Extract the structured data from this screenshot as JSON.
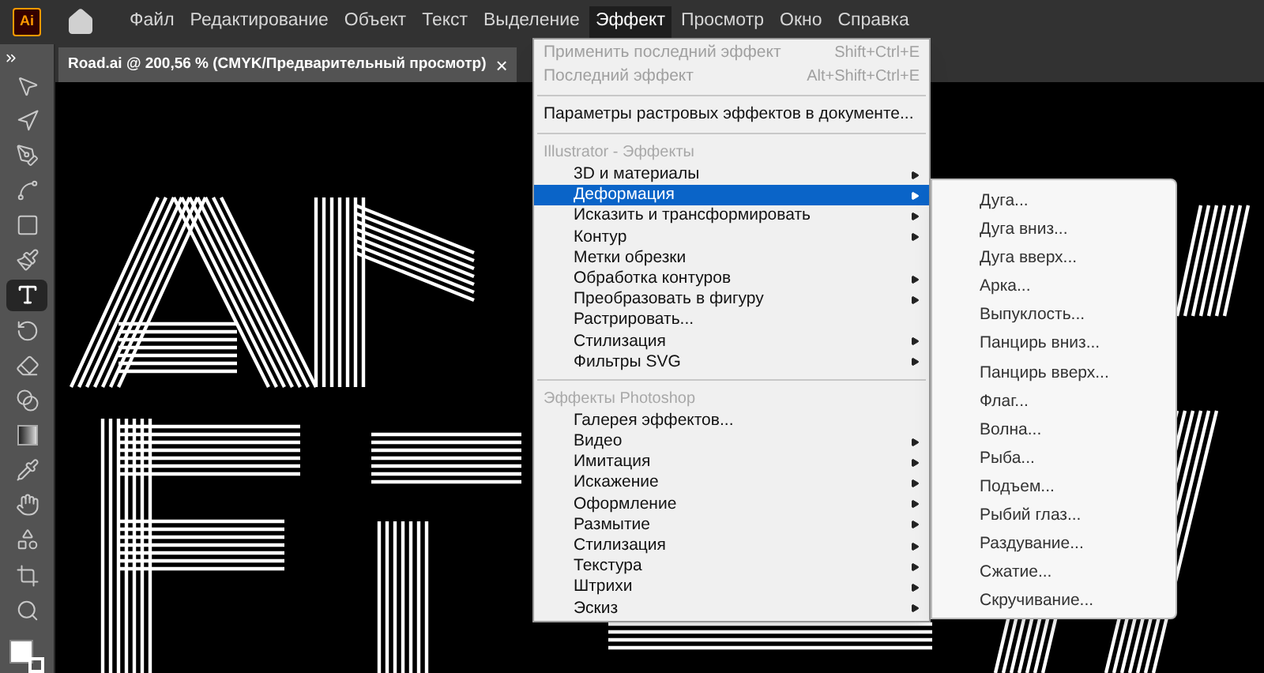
{
  "app": {
    "logo": "Ai"
  },
  "menubar": [
    {
      "label": "Файл",
      "selected": false
    },
    {
      "label": "Редактирование",
      "selected": false
    },
    {
      "label": "Объект",
      "selected": false
    },
    {
      "label": "Текст",
      "selected": false
    },
    {
      "label": "Выделение",
      "selected": false
    },
    {
      "label": "Эффект",
      "selected": true
    },
    {
      "label": "Просмотр",
      "selected": false
    },
    {
      "label": "Окно",
      "selected": false
    },
    {
      "label": "Справка",
      "selected": false
    }
  ],
  "document_tab": {
    "title": "Road.ai @ 200,56 % (CMYK/Предварительный просмотр)",
    "close": "×"
  },
  "tools": [
    {
      "kind": "select",
      "selected": false
    },
    {
      "kind": "direct",
      "selected": false
    },
    {
      "kind": "pen",
      "selected": false
    },
    {
      "kind": "curvature",
      "selected": false
    },
    {
      "kind": "rectangle",
      "selected": false
    },
    {
      "kind": "brush",
      "selected": false
    },
    {
      "kind": "type",
      "selected": true
    },
    {
      "kind": "rotate",
      "selected": false
    },
    {
      "kind": "eraser",
      "selected": false
    },
    {
      "kind": "shapebuilder",
      "selected": false
    },
    {
      "kind": "gradient",
      "selected": false
    },
    {
      "kind": "eyedropper",
      "selected": false
    },
    {
      "kind": "puppet",
      "selected": false
    },
    {
      "kind": "shapes",
      "selected": false
    },
    {
      "kind": "artboard",
      "selected": false
    },
    {
      "kind": "zoom",
      "selected": false
    }
  ],
  "effect_menu": [
    {
      "kind": "item",
      "label": "Применить последний эффект",
      "shortcut": "Shift+Ctrl+E",
      "disabled": true,
      "submenu": false,
      "selected": false
    },
    {
      "kind": "item",
      "label": "Последний эффект",
      "shortcut": "Alt+Shift+Ctrl+E",
      "disabled": true,
      "submenu": false,
      "selected": false
    },
    {
      "kind": "separator"
    },
    {
      "kind": "item",
      "label": "Параметры растровых эффектов в документе...",
      "disabled": false,
      "submenu": false,
      "selected": false
    },
    {
      "kind": "separator"
    },
    {
      "kind": "header",
      "label": "Illustrator - Эффекты"
    },
    {
      "kind": "item",
      "label": "3D и материалы",
      "disabled": false,
      "submenu": true,
      "selected": false
    },
    {
      "kind": "item",
      "label": "Деформация",
      "disabled": false,
      "submenu": true,
      "selected": true
    },
    {
      "kind": "item",
      "label": "Исказить и трансформировать",
      "disabled": false,
      "submenu": true,
      "selected": false
    },
    {
      "kind": "item",
      "label": "Контур",
      "disabled": false,
      "submenu": true,
      "selected": false
    },
    {
      "kind": "item",
      "label": "Метки обрезки",
      "disabled": false,
      "submenu": false,
      "selected": false
    },
    {
      "kind": "item",
      "label": "Обработка контуров",
      "disabled": false,
      "submenu": true,
      "selected": false
    },
    {
      "kind": "item",
      "label": "Преобразовать в фигуру",
      "disabled": false,
      "submenu": true,
      "selected": false
    },
    {
      "kind": "item",
      "label": "Растрировать...",
      "disabled": false,
      "submenu": false,
      "selected": false
    },
    {
      "kind": "item",
      "label": "Стилизация",
      "disabled": false,
      "submenu": true,
      "selected": false
    },
    {
      "kind": "item",
      "label": "Фильтры SVG",
      "disabled": false,
      "submenu": true,
      "selected": false
    },
    {
      "kind": "separator"
    },
    {
      "kind": "header",
      "label": "Эффекты Photoshop"
    },
    {
      "kind": "item",
      "label": "Галерея эффектов...",
      "disabled": false,
      "submenu": false,
      "selected": false
    },
    {
      "kind": "item",
      "label": "Видео",
      "disabled": false,
      "submenu": true,
      "selected": false
    },
    {
      "kind": "item",
      "label": "Имитация",
      "disabled": false,
      "submenu": true,
      "selected": false
    },
    {
      "kind": "item",
      "label": "Искажение",
      "disabled": false,
      "submenu": true,
      "selected": false
    },
    {
      "kind": "item",
      "label": "Оформление",
      "disabled": false,
      "submenu": true,
      "selected": false
    },
    {
      "kind": "item",
      "label": "Размытие",
      "disabled": false,
      "submenu": true,
      "selected": false
    },
    {
      "kind": "item",
      "label": "Стилизация",
      "disabled": false,
      "submenu": true,
      "selected": false
    },
    {
      "kind": "item",
      "label": "Текстура",
      "disabled": false,
      "submenu": true,
      "selected": false
    },
    {
      "kind": "item",
      "label": "Штрихи",
      "disabled": false,
      "submenu": true,
      "selected": false
    },
    {
      "kind": "item",
      "label": "Эскиз",
      "disabled": false,
      "submenu": true,
      "selected": false
    }
  ],
  "warp_submenu": [
    "Дуга...",
    "Дуга вниз...",
    "Дуга вверх...",
    "Арка...",
    "Выпуклость...",
    "Панцирь вниз...",
    "Панцирь вверх...",
    "Флаг...",
    "Волна...",
    "Рыба...",
    "Подъем...",
    "Рыбий глаз...",
    "Раздувание...",
    "Сжатие...",
    "Скручивание..."
  ]
}
